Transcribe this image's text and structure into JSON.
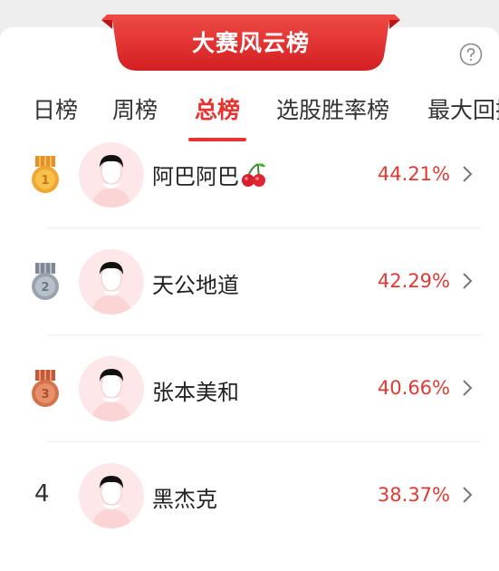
{
  "banner": {
    "title": "大赛风云榜"
  },
  "help": {
    "icon": "help-circle-icon"
  },
  "tabs": [
    {
      "label": "日榜",
      "active": false
    },
    {
      "label": "周榜",
      "active": false
    },
    {
      "label": "总榜",
      "active": true
    },
    {
      "label": "选股胜率榜",
      "active": false
    },
    {
      "label": "最大回撤",
      "active": false
    }
  ],
  "colors": {
    "accent": "#e8322f",
    "percent": "#e03a34",
    "gold": "#f0a630",
    "silver": "#9aa2ad",
    "bronze": "#d4734a",
    "avatar_bg": "#fde7e8"
  },
  "leaderboard": [
    {
      "rank": "1",
      "badge": "gold-medal-icon",
      "name": "阿巴阿巴",
      "emoji": "cherry-icon",
      "percent": "44.21%"
    },
    {
      "rank": "2",
      "badge": "silver-medal-icon",
      "name": "天公地道",
      "percent": "42.29%"
    },
    {
      "rank": "3",
      "badge": "bronze-medal-icon",
      "name": "张本美和",
      "percent": "40.66%"
    },
    {
      "rank": "4",
      "name": "黑杰克",
      "percent": "38.37%"
    }
  ]
}
